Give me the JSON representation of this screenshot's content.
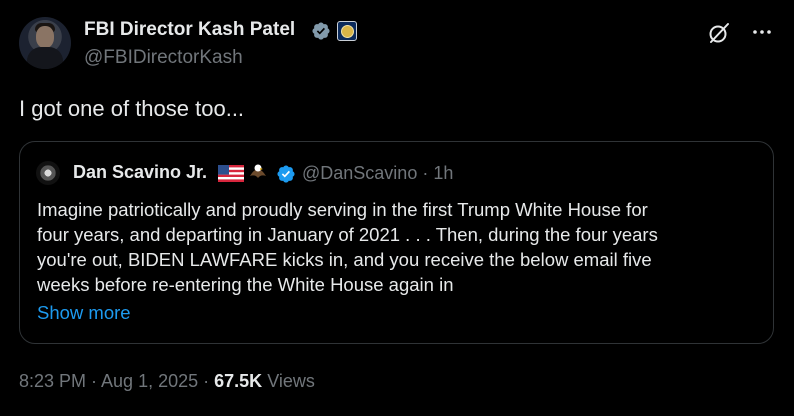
{
  "post": {
    "author": {
      "display_name": "FBI Director Kash Patel",
      "handle": "@FBIDirectorKash"
    },
    "text": "I got one of those too...",
    "timestamp": "8:23 PM · Aug 1, 2025",
    "separator": " · ",
    "views_count": "67.5K",
    "views_label": "Views"
  },
  "quote": {
    "author": {
      "display_name": "Dan Scavino Jr.",
      "handle_time": "@DanScavino · 1h"
    },
    "body_lines": [
      "Imagine patriotically and proudly serving in the first Trump White House for",
      "four years, and departing in January of 2021 . . . Then, during the four years",
      "you're out, BIDEN LAWFARE kicks in, and you receive the below email five",
      "weeks before re-entering the White House again in"
    ],
    "show_more_label": "Show more"
  },
  "icons": {
    "verified": "verified-badge-icon",
    "org_badge": "fbi-seal-icon",
    "grok": "grok-icon",
    "more": "more-icon",
    "flag": "us-flag-icon",
    "eagle": "eagle-icon"
  },
  "colors": {
    "background": "#000000",
    "text": "#e7e9ea",
    "secondary_text": "#71767b",
    "accent": "#1d9bf0",
    "border": "#2f3336"
  }
}
